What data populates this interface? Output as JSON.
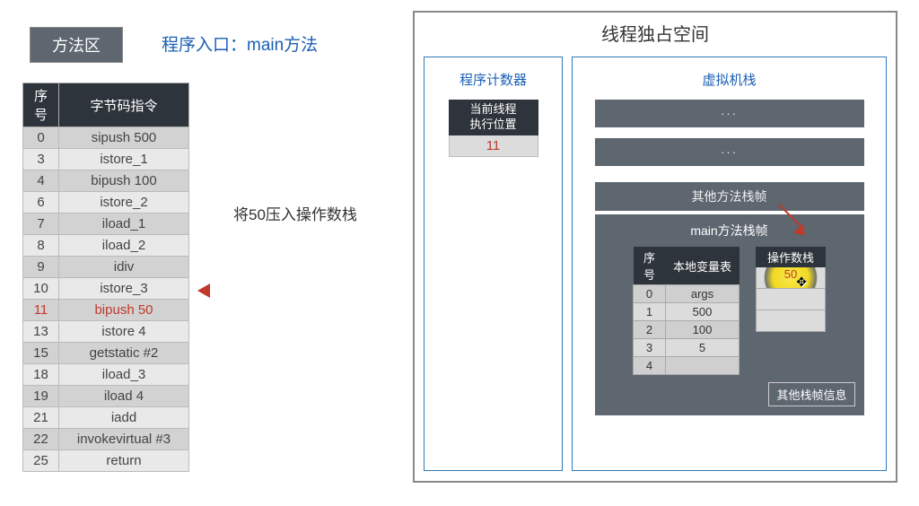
{
  "method_area": {
    "label": "方法区",
    "entry_text": "程序入口：main方法",
    "side_caption": "将50压入操作数栈",
    "table_headers": {
      "idx": "序号",
      "instr": "字节码指令"
    },
    "rows": [
      {
        "idx": "0",
        "instr": "sipush 500"
      },
      {
        "idx": "3",
        "instr": "istore_1"
      },
      {
        "idx": "4",
        "instr": "bipush 100"
      },
      {
        "idx": "6",
        "instr": "istore_2"
      },
      {
        "idx": "7",
        "instr": "iload_1"
      },
      {
        "idx": "8",
        "instr": "iload_2"
      },
      {
        "idx": "9",
        "instr": "idiv"
      },
      {
        "idx": "10",
        "instr": "istore_3"
      },
      {
        "idx": "11",
        "instr": "bipush 50",
        "active": true
      },
      {
        "idx": "13",
        "instr": "istore 4"
      },
      {
        "idx": "15",
        "instr": "getstatic #2"
      },
      {
        "idx": "18",
        "instr": "iload_3"
      },
      {
        "idx": "19",
        "instr": "iload 4"
      },
      {
        "idx": "21",
        "instr": "iadd"
      },
      {
        "idx": "22",
        "instr": "invokevirtual #3"
      },
      {
        "idx": "25",
        "instr": "return"
      }
    ]
  },
  "thread_space": {
    "title": "线程独占空间",
    "pc": {
      "title": "程序计数器",
      "label_line1": "当前线程",
      "label_line2": "执行位置",
      "value": "11"
    },
    "vm_stack": {
      "title": "虚拟机栈",
      "bar1": "···",
      "bar2": "···",
      "other_frame_label": "其他方法栈帧",
      "main_frame": {
        "title": "main方法栈帧",
        "lv_headers": {
          "idx": "序号",
          "val": "本地变量表"
        },
        "lv_rows": [
          {
            "idx": "0",
            "val": "args"
          },
          {
            "idx": "1",
            "val": "500"
          },
          {
            "idx": "2",
            "val": "100"
          },
          {
            "idx": "3",
            "val": "5"
          },
          {
            "idx": "4",
            "val": ""
          }
        ],
        "op_stack_header": "操作数栈",
        "op_stack": [
          {
            "val": "50",
            "highlight": true
          },
          {
            "val": ""
          },
          {
            "val": ""
          }
        ],
        "other_info": "其他栈帧信息"
      }
    }
  }
}
